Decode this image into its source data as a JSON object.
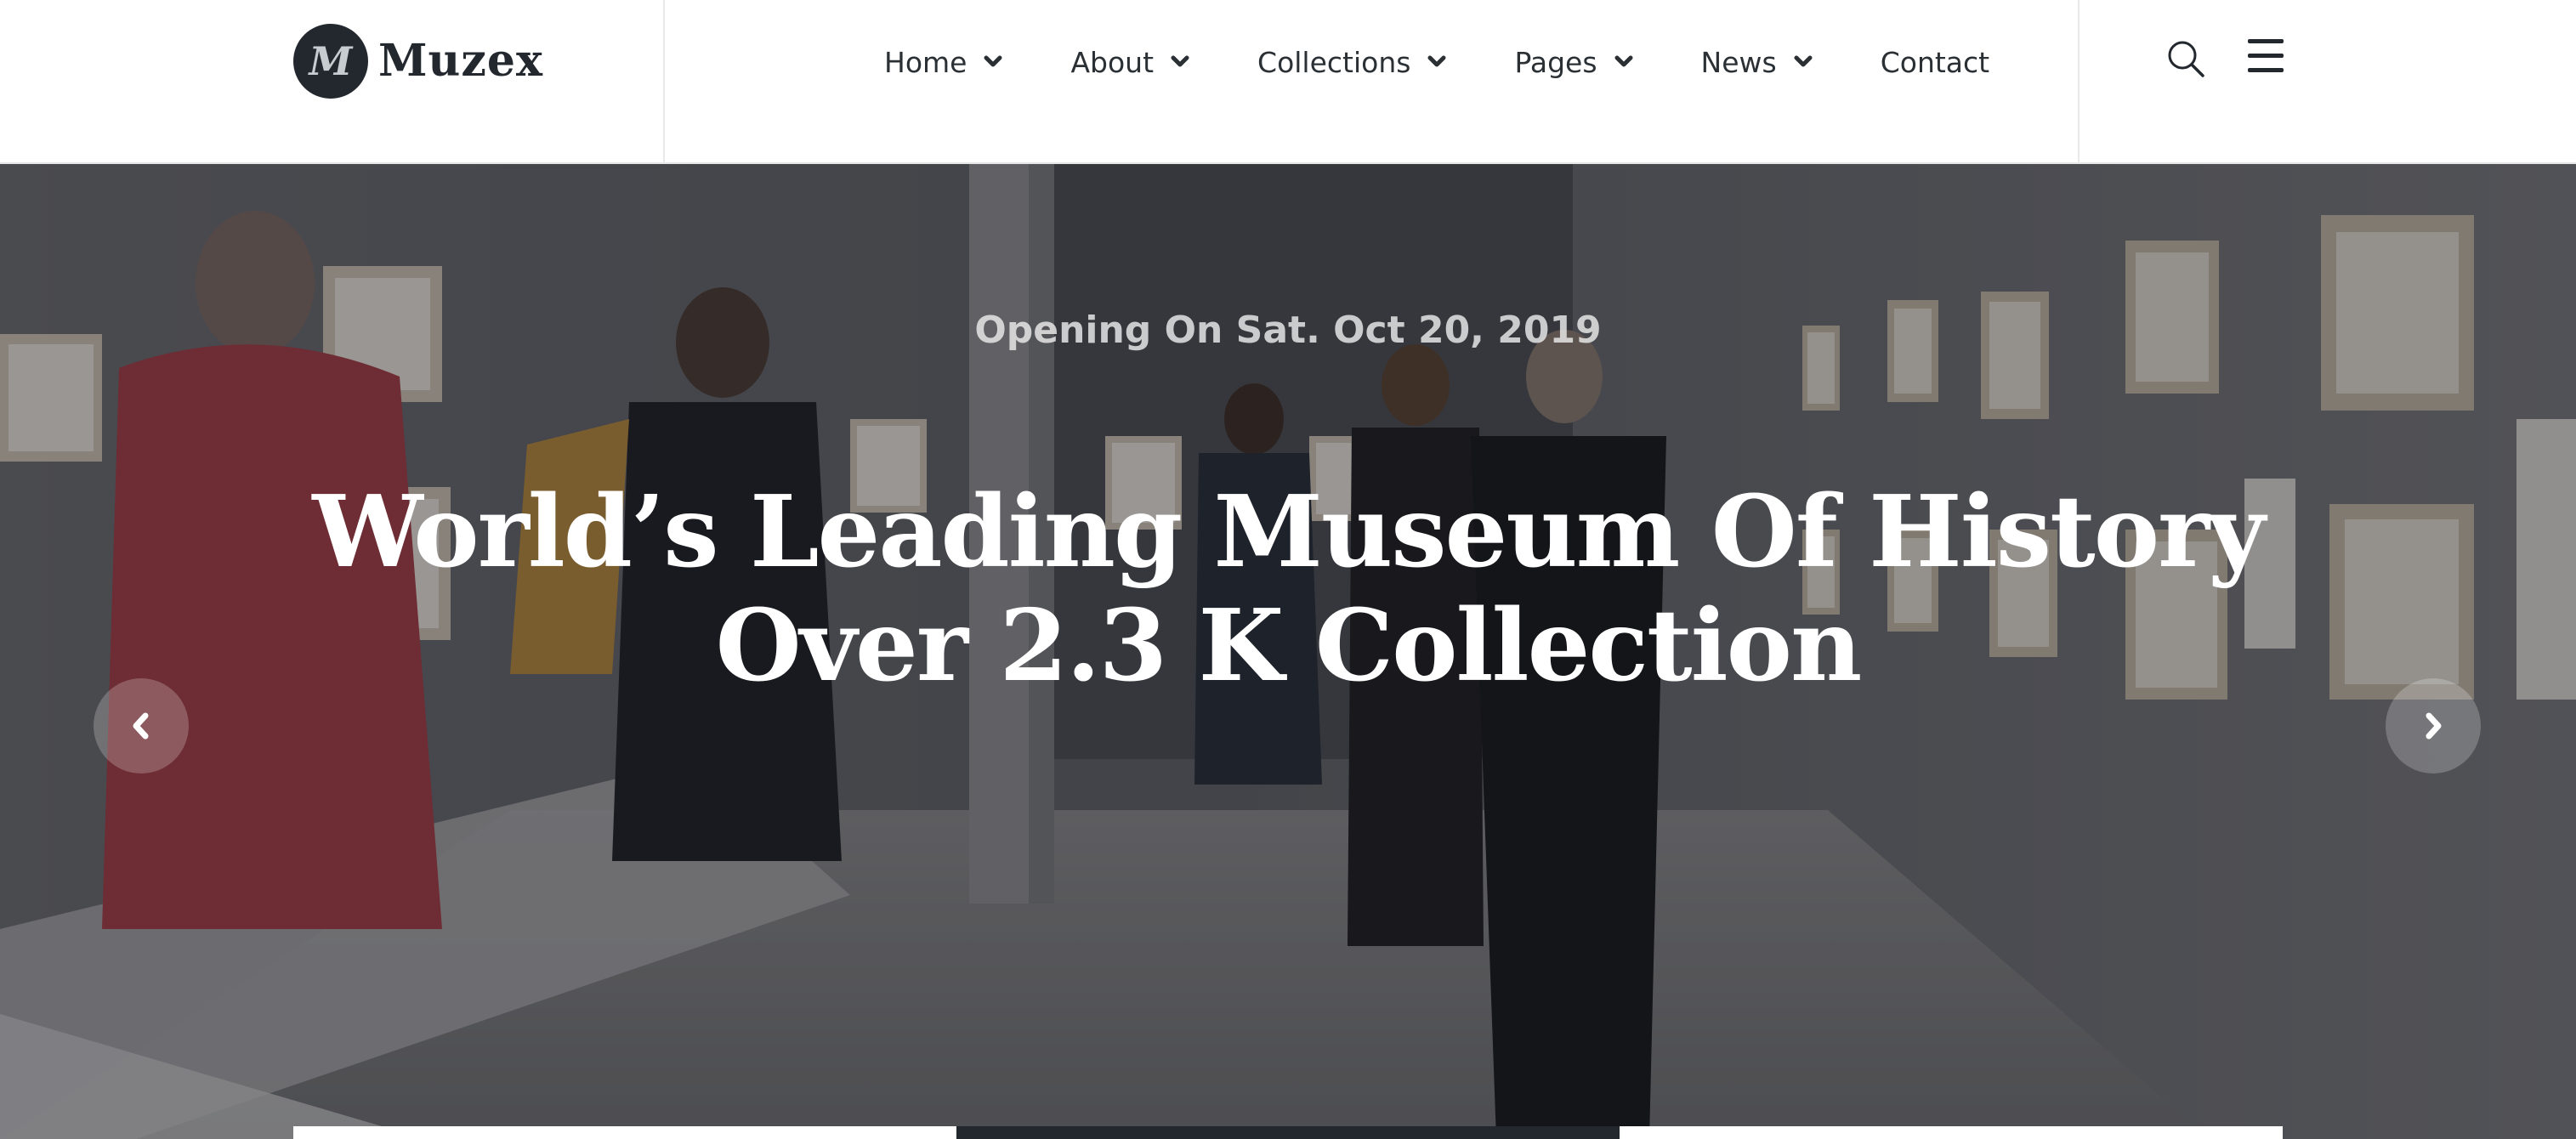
{
  "brand": {
    "logo_letter": "M",
    "name": "Muzex"
  },
  "nav": {
    "items": [
      {
        "label": "Home",
        "has_dropdown": true
      },
      {
        "label": "About",
        "has_dropdown": true
      },
      {
        "label": "Collections",
        "has_dropdown": true
      },
      {
        "label": "Pages",
        "has_dropdown": true
      },
      {
        "label": "News",
        "has_dropdown": true
      },
      {
        "label": "Contact",
        "has_dropdown": false
      }
    ]
  },
  "header_tools": {
    "search_icon": "search-icon",
    "menu_icon": "hamburger-menu-icon"
  },
  "hero": {
    "subtitle": "Opening On Sat. Oct 20, 2019",
    "title_line1": "World’s Leading Museum Of History",
    "title_line2": "Over 2.3 K Collection",
    "prev_icon": "chevron-left-icon",
    "next_icon": "chevron-right-icon",
    "background": "museum gallery photo"
  },
  "bottom_tabs": {
    "count": 3,
    "active_index": 1
  },
  "colors": {
    "dark": "#22282e",
    "text": "#2b3035",
    "white": "#ffffff"
  }
}
